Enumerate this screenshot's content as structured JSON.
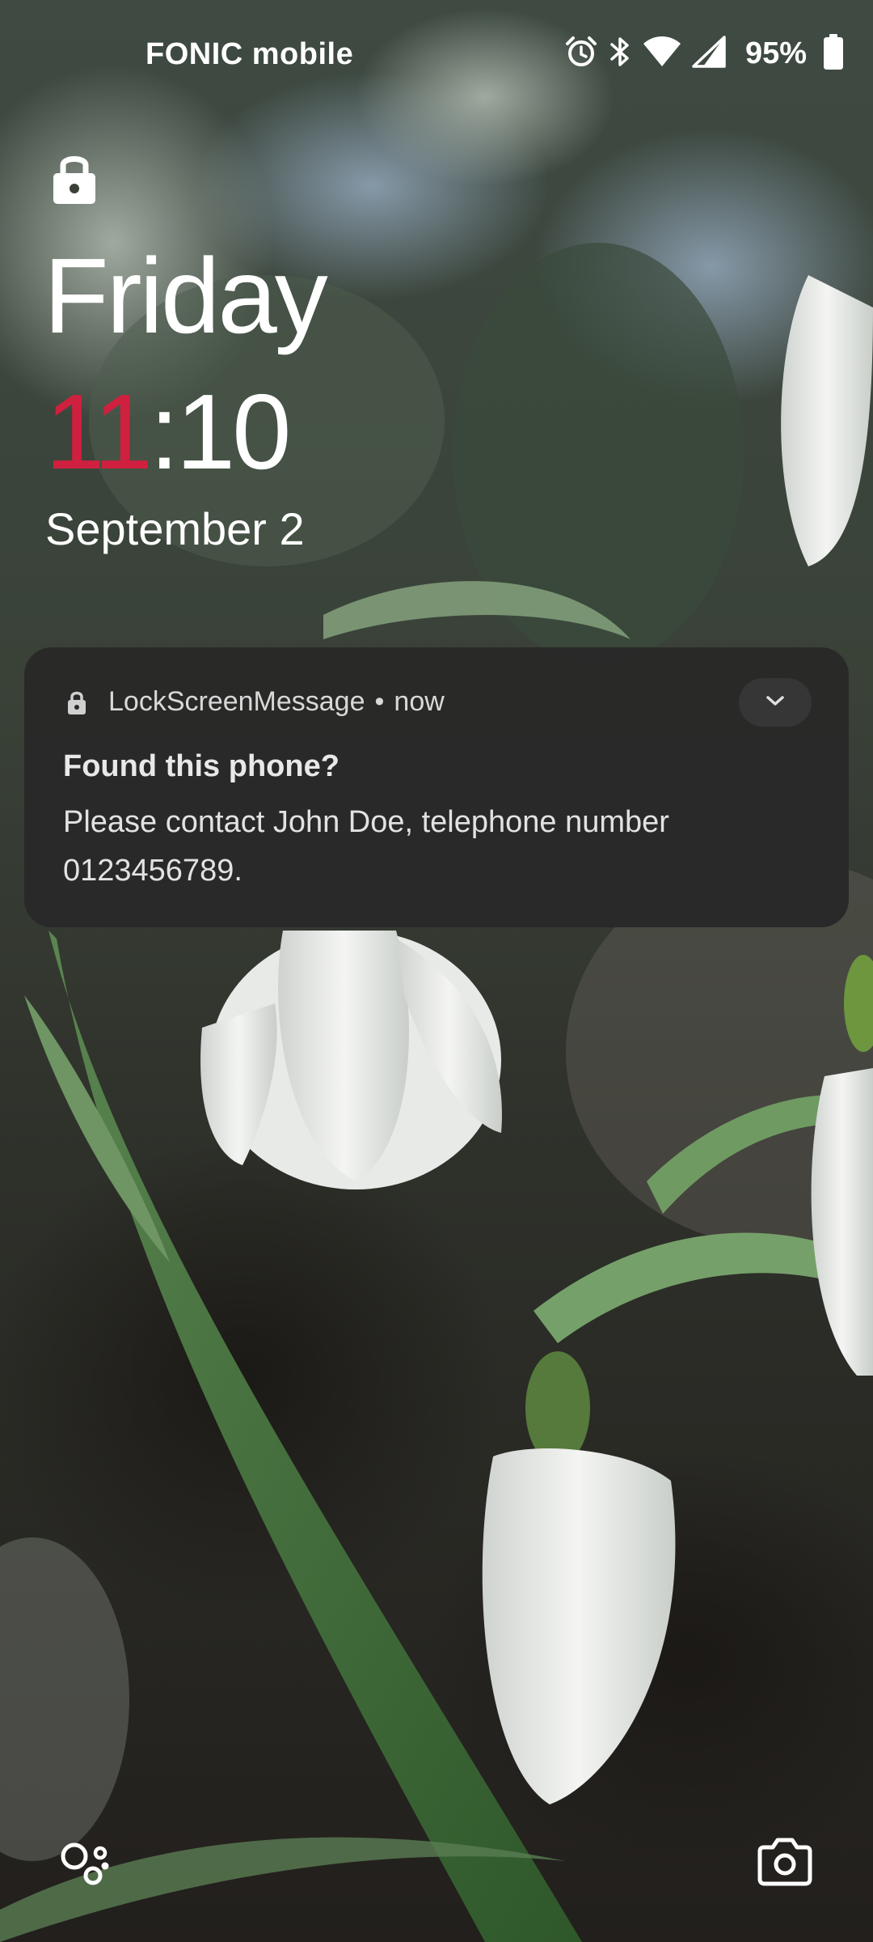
{
  "status_bar": {
    "carrier": "FONIC mobile",
    "battery_percent": "95%",
    "icons": [
      "alarm-icon",
      "bluetooth-icon",
      "wifi-icon",
      "cell-signal-icon",
      "battery-icon"
    ]
  },
  "lock_screen": {
    "lock_icon": "padlock-icon",
    "day": "Friday",
    "time_hour": "11",
    "time_separator": ":",
    "time_minutes": "10",
    "date": "September 2"
  },
  "notification": {
    "app_name": "LockScreenMessage",
    "separator": "•",
    "time": "now",
    "title": "Found this phone?",
    "body": "Please contact John Doe, telephone number 0123456789.",
    "expand_icon": "chevron-down-icon"
  },
  "bottom_shortcuts": {
    "left": "assistant-icon",
    "right": "camera-icon"
  },
  "colors": {
    "clock_accent": "#d0203f",
    "notification_bg": "#282828",
    "text_white": "#ffffff"
  }
}
